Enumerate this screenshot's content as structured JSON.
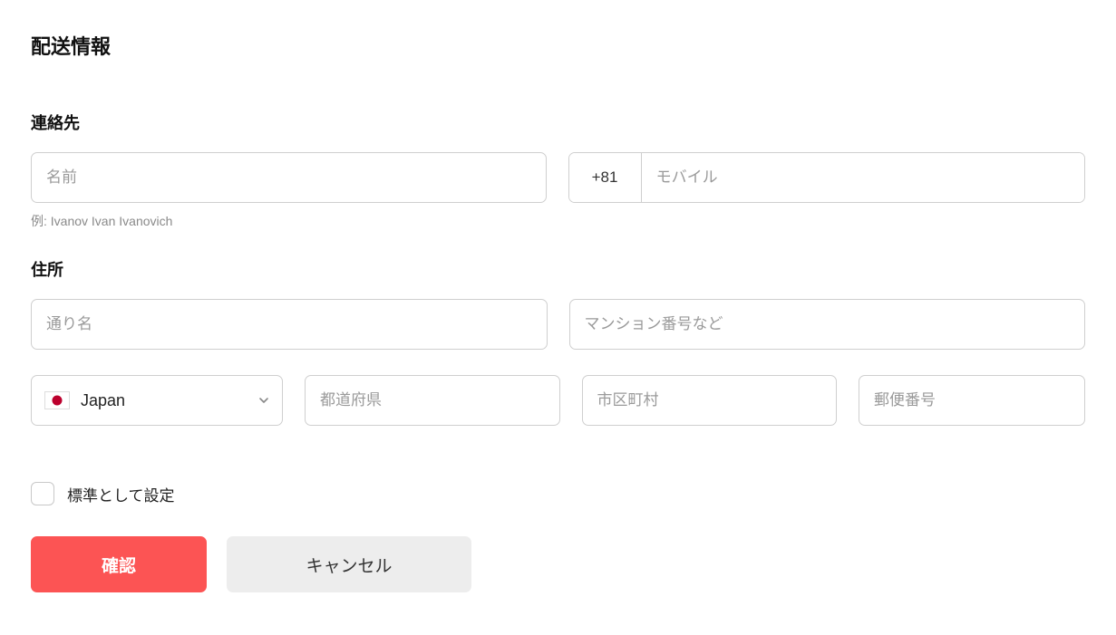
{
  "title": "配送情報",
  "contact": {
    "label": "連絡先",
    "name_placeholder": "名前",
    "name_hint": "例: Ivanov Ivan Ivanovich",
    "phone_prefix": "+81",
    "phone_placeholder": "モバイル"
  },
  "address": {
    "label": "住所",
    "street_placeholder": "通り名",
    "apartment_placeholder": "マンション番号など",
    "country": "Japan",
    "prefecture_placeholder": "都道府県",
    "city_placeholder": "市区町村",
    "postal_placeholder": "郵便番号"
  },
  "default_checkbox_label": "標準として設定",
  "buttons": {
    "confirm": "確認",
    "cancel": "キャンセル"
  }
}
